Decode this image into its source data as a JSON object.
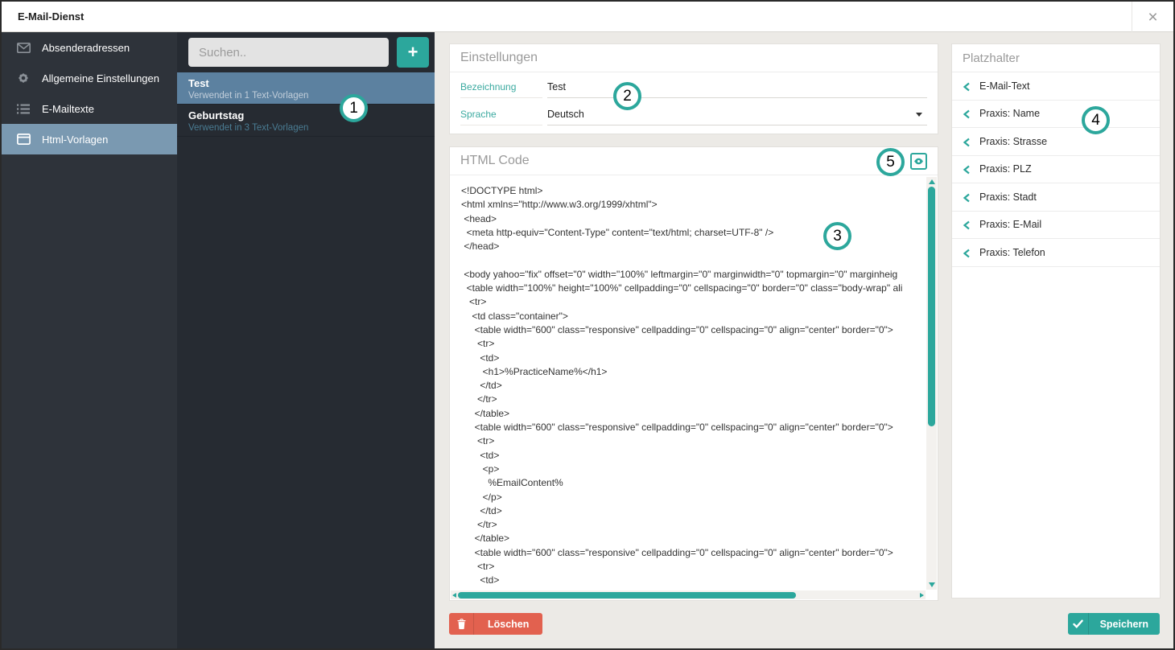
{
  "window": {
    "title": "E-Mail-Dienst",
    "close_icon": "×"
  },
  "sidebar": {
    "items": [
      {
        "label": "Absenderadressen",
        "icon": "envelope-icon",
        "active": false
      },
      {
        "label": "Allgemeine Einstellungen",
        "icon": "gear-icon",
        "active": false
      },
      {
        "label": "E-Mailtexte",
        "icon": "list-icon",
        "active": false
      },
      {
        "label": "Html-Vorlagen",
        "icon": "window-icon",
        "active": true
      }
    ]
  },
  "template_list": {
    "search_placeholder": "Suchen..",
    "add_button_label": "+",
    "items": [
      {
        "title": "Test",
        "subtitle": "Verwendet in 1 Text-Vorlagen",
        "selected": true
      },
      {
        "title": "Geburtstag",
        "subtitle": "Verwendet in 3 Text-Vorlagen",
        "selected": false
      }
    ]
  },
  "settings": {
    "header": "Einstellungen",
    "fields": [
      {
        "label": "Bezeichnung",
        "value": "Test",
        "type": "text"
      },
      {
        "label": "Sprache",
        "value": "Deutsch",
        "type": "dropdown"
      }
    ]
  },
  "html_code": {
    "header": "HTML Code",
    "preview_icon": "eye-icon",
    "code_lines": [
      "<!DOCTYPE html>",
      "<html xmlns=\"http://www.w3.org/1999/xhtml\">",
      " <head>",
      "  <meta http-equiv=\"Content-Type\" content=\"text/html; charset=UTF-8\" />",
      " </head>",
      "",
      " <body yahoo=\"fix\" offset=\"0\" width=\"100%\" leftmargin=\"0\" marginwidth=\"0\" topmargin=\"0\" marginheig",
      "  <table width=\"100%\" height=\"100%\" cellpadding=\"0\" cellspacing=\"0\" border=\"0\" class=\"body-wrap\" ali",
      "   <tr>",
      "    <td class=\"container\">",
      "     <table width=\"600\" class=\"responsive\" cellpadding=\"0\" cellspacing=\"0\" align=\"center\" border=\"0\">",
      "      <tr>",
      "       <td>",
      "        <h1>%PracticeName%</h1>",
      "       </td>",
      "      </tr>",
      "     </table>",
      "     <table width=\"600\" class=\"responsive\" cellpadding=\"0\" cellspacing=\"0\" align=\"center\" border=\"0\">",
      "      <tr>",
      "       <td>",
      "        <p>",
      "          %EmailContent%",
      "        </p>",
      "       </td>",
      "      </tr>",
      "     </table>",
      "     <table width=\"600\" class=\"responsive\" cellpadding=\"0\" cellspacing=\"0\" align=\"center\" border=\"0\">",
      "      <tr>",
      "       <td>"
    ]
  },
  "placeholders": {
    "header": "Platzhalter",
    "items": [
      "E-Mail-Text",
      "Praxis: Name",
      "Praxis: Strasse",
      "Praxis: PLZ",
      "Praxis: Stadt",
      "Praxis: E-Mail",
      "Praxis: Telefon"
    ]
  },
  "actions": {
    "delete_label": "Löschen",
    "save_label": "Speichern"
  },
  "annotations": [
    {
      "label": "1"
    },
    {
      "label": "2"
    },
    {
      "label": "3"
    },
    {
      "label": "4"
    },
    {
      "label": "5"
    }
  ],
  "colors": {
    "accent_teal": "#2CA79C",
    "danger_red": "#E2614F",
    "sidebar_bg": "#2E333A",
    "sidebar_active": "#7A99B1",
    "list_bg": "#262B32",
    "list_selected": "#5C81A0",
    "main_bg": "#ECEAE6",
    "label_teal": "#3BAAA0"
  }
}
